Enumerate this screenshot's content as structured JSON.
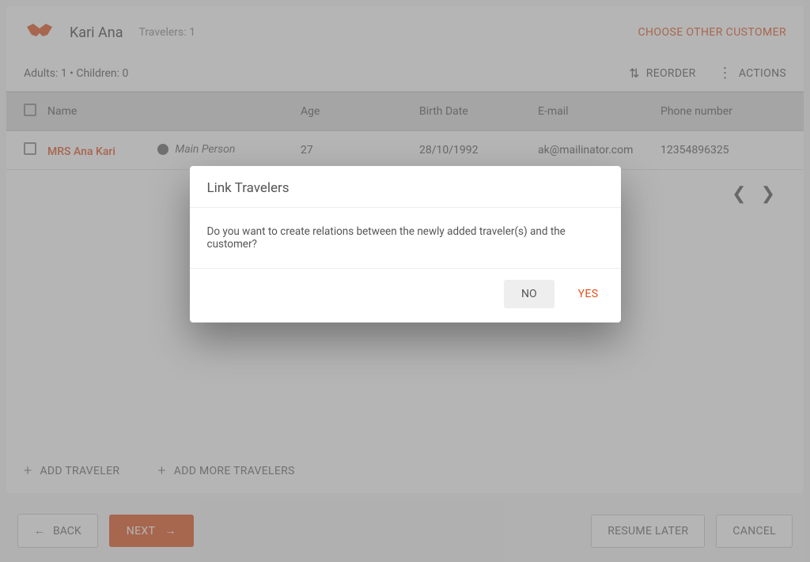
{
  "header": {
    "customer_name": "Kari Ana",
    "travelers_label": "Travelers: 1",
    "choose_other": "CHOOSE OTHER CUSTOMER"
  },
  "subbar": {
    "counts": "Adults: 1 • Children: 0",
    "reorder": "REORDER",
    "actions": "ACTIONS"
  },
  "table": {
    "headers": {
      "name": "Name",
      "age": "Age",
      "birth": "Birth Date",
      "email": "E-mail",
      "phone": "Phone number"
    },
    "rows": [
      {
        "name": "MRS Ana Kari",
        "role": "Main Person",
        "age": "27",
        "birth": "28/10/1992",
        "email": "ak@mailinator.com",
        "phone": "12354896325"
      }
    ]
  },
  "add": {
    "add_traveler": "ADD TRAVELER",
    "add_more": "ADD MORE TRAVELERS"
  },
  "footer": {
    "back": "BACK",
    "next": "NEXT",
    "resume": "RESUME LATER",
    "cancel": "CANCEL"
  },
  "dialog": {
    "title": "Link Travelers",
    "body": "Do you want to create relations between the newly added traveler(s) and the customer?",
    "no": "NO",
    "yes": "YES"
  }
}
